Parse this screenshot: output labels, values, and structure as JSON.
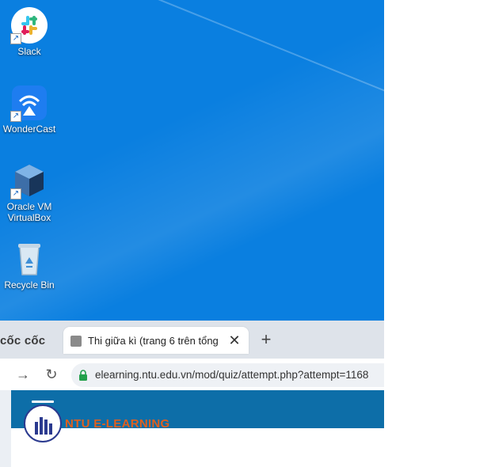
{
  "desktop": {
    "icons": [
      {
        "label": "Slack",
        "icon": "slack-icon"
      },
      {
        "label": "WonderCast",
        "icon": "wondercast-icon"
      },
      {
        "label": "Oracle VM VirtualBox",
        "icon": "virtualbox-icon"
      },
      {
        "label": "Recycle Bin",
        "icon": "recycle-bin-icon"
      }
    ]
  },
  "browser": {
    "brand": "cốc cốc",
    "tab": {
      "title": "Thi giữa kì (trang 6 trên tổng",
      "close": "✕"
    },
    "new_tab": "+",
    "toolbar": {
      "forward": "→",
      "reload": "↻",
      "url": "elearning.ntu.edu.vn/mod/quiz/attempt.php?attempt=1168"
    },
    "page": {
      "site_name": "NTU E-LEARNING"
    }
  },
  "colors": {
    "desktop": "#0a7fe0",
    "navbar": "#0d6ea8",
    "logo_text": "#e2601d"
  }
}
